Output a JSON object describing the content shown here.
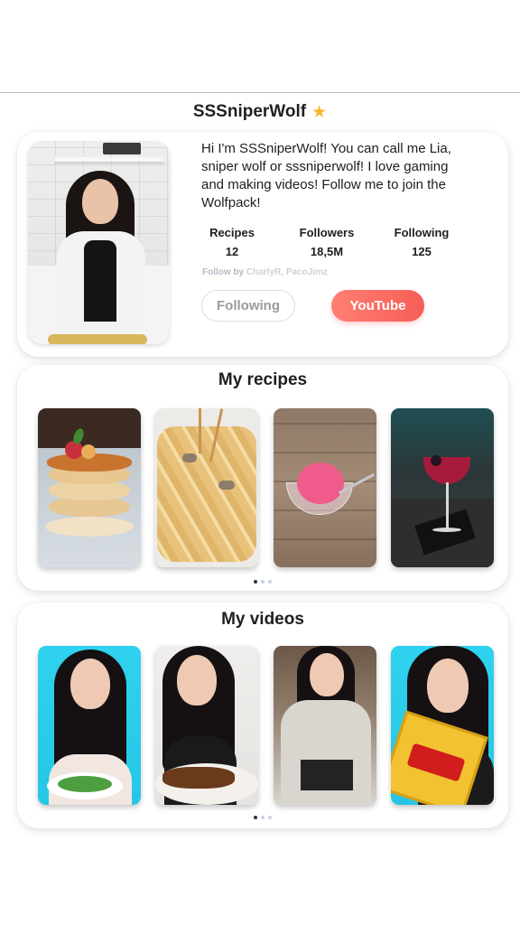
{
  "profile": {
    "username": "SSSniperWolf",
    "verified_icon": "star-icon",
    "bio": "Hi I'm SSSniperWolf! You can call me Lia, sniper wolf or sssniperwolf! I love gaming and making videos! Follow me to join the Wolfpack!",
    "stats": [
      {
        "label": "Recipes",
        "value": "12"
      },
      {
        "label": "Followers",
        "value": "18,5M"
      },
      {
        "label": "Following",
        "value": "125"
      }
    ],
    "followed_by_prefix": "Follow by",
    "followed_by_names": "CharlyR, PacoJimz",
    "following_button": "Following",
    "youtube_button": "YouTube"
  },
  "recipes": {
    "title": "My recipes",
    "items": [
      {
        "name": "pancakes"
      },
      {
        "name": "pasta"
      },
      {
        "name": "ice cream"
      },
      {
        "name": "cocktail"
      }
    ],
    "page_count": 3,
    "active_page": 1
  },
  "videos": {
    "title": "My videos",
    "items": [
      {
        "name": "video 1"
      },
      {
        "name": "video 2"
      },
      {
        "name": "video 3"
      },
      {
        "name": "video 4"
      }
    ],
    "page_count": 3,
    "active_page": 1
  },
  "colors": {
    "accent": "#f65e58",
    "star": "#f5b82e",
    "pager_active": "#2d3240",
    "pager_inactive": "#c9d3e0"
  }
}
